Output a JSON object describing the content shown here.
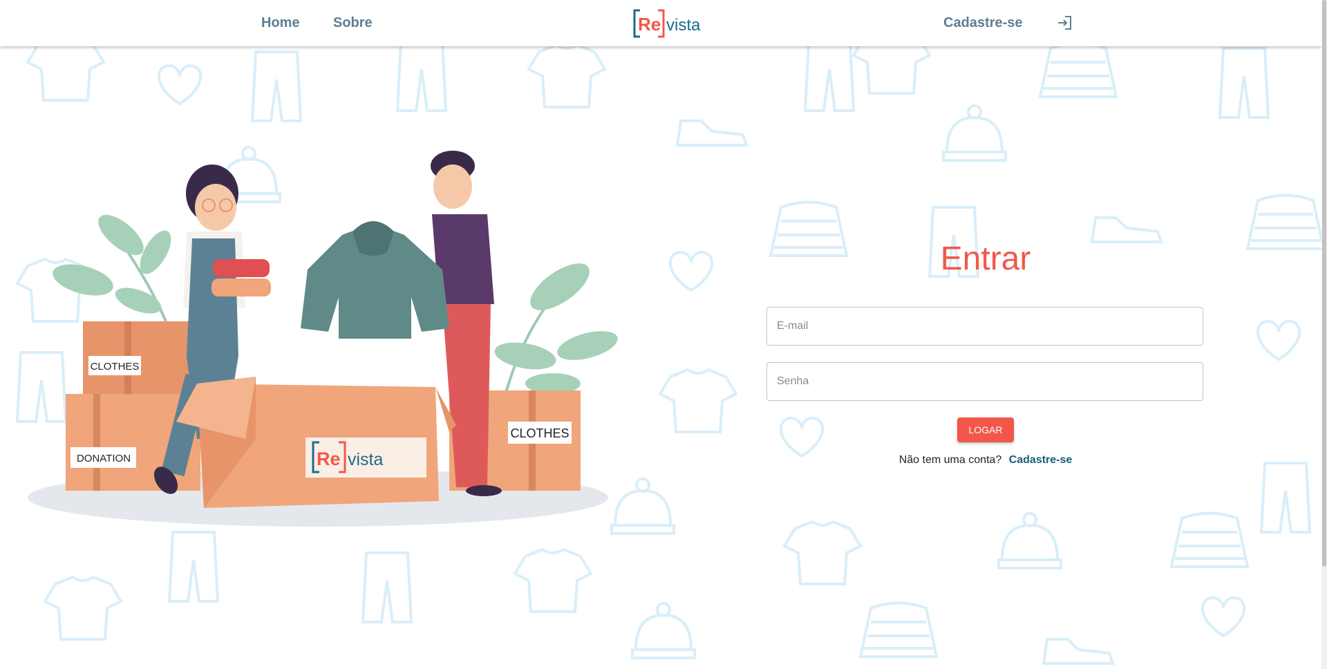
{
  "nav": {
    "home_label": "Home",
    "about_label": "Sobre",
    "signup_label": "Cadastre-se",
    "logo_prefix": "Re",
    "logo_suffix": "vista",
    "login_icon": "login-enter-icon"
  },
  "illustration": {
    "box_label_1": "CLOTHES",
    "box_label_2": "DONATION",
    "box_label_3": "CLOTHES",
    "box_logo_prefix": "Re",
    "box_logo_suffix": "vista"
  },
  "form": {
    "title": "Entrar",
    "email_placeholder": "E-mail",
    "password_placeholder": "Senha",
    "submit_label": "LOGAR",
    "no_account_text": "Não tem uma conta?",
    "signup_link": "Cadastre-se"
  },
  "colors": {
    "accent": "#f2574a",
    "nav_text": "#5b7f92",
    "link": "#1a5e7a",
    "pattern": "#d9eef9"
  }
}
